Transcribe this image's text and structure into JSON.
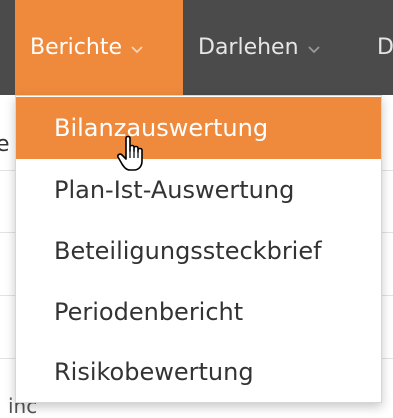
{
  "nav": {
    "items": [
      {
        "label": "Berichte",
        "active": true,
        "icon": "chevron-down-icon"
      },
      {
        "label": "Darlehen",
        "active": false,
        "icon": "chevron-down-icon"
      },
      {
        "label": "D",
        "active": false
      }
    ]
  },
  "background": {
    "left_text": "e",
    "bottom_text": "inc"
  },
  "dropdown": {
    "items": [
      {
        "label": "Bilanzauswertung",
        "highlighted": true
      },
      {
        "label": "Plan-Ist-Auswertung"
      },
      {
        "label": "Beteiligungssteckbrief"
      },
      {
        "label": "Periodenbericht"
      },
      {
        "label": "Risikobewertung"
      }
    ]
  },
  "cursor": {
    "icon": "hand-pointer-icon"
  },
  "colors": {
    "accent": "#ef8a3c",
    "topbar": "#4b4b4b",
    "nav_text": "#e6e6e6",
    "menu_text": "#333333"
  }
}
